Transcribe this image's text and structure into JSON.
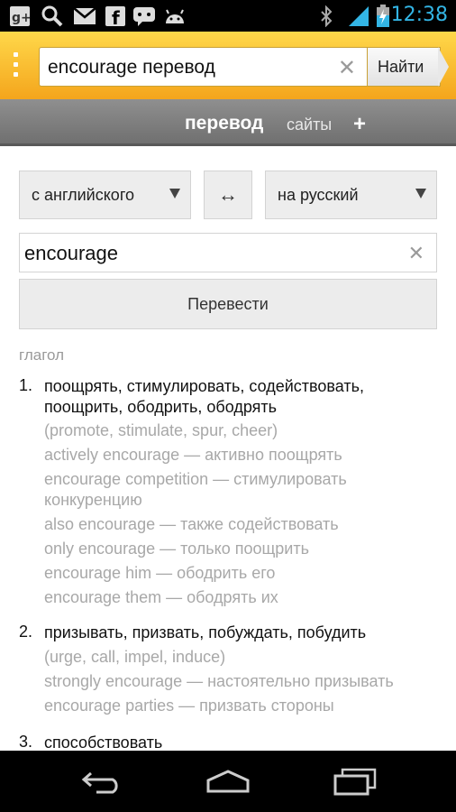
{
  "status_bar": {
    "time": "12:38",
    "left_icons": [
      "google-plus-icon",
      "search-icon",
      "gmail-icon",
      "facebook-icon",
      "talk-icon",
      "android-icon"
    ],
    "right_icons": [
      "bluetooth-icon",
      "signal-icon",
      "battery-charging-icon"
    ],
    "accent_color": "#33b5e5"
  },
  "search": {
    "query": "encourage перевод",
    "button_label": "Найти"
  },
  "tabs": [
    {
      "label": "перевод",
      "active": true
    },
    {
      "label": "сайты",
      "active": false
    },
    {
      "label": "+",
      "active": false
    }
  ],
  "translator": {
    "from_lang": "с английского",
    "to_lang": "на русский",
    "swap_symbol": "↔",
    "input_word": "encourage",
    "translate_label": "Перевести"
  },
  "results": {
    "part_of_speech": "глагол",
    "entries": [
      {
        "number": "1.",
        "main": "поощрять, стимулировать, содействовать, поощрить, ободрить, ободрять",
        "lines": [
          "(promote, stimulate, spur, cheer)",
          "actively encourage — активно поощрять",
          "encourage competition — стимулировать",
          "конкуренцию",
          "also encourage — также содействовать",
          "only encourage — только поощрить",
          "encourage him — ободрить его",
          "encourage them — ободрять их"
        ]
      },
      {
        "number": "2.",
        "main": "призывать, призвать, побуждать, побудить",
        "lines": [
          "(urge, call, impel, induce)",
          "strongly encourage — настоятельно призывать",
          "encourage parties — призвать стороны"
        ]
      },
      {
        "number": "3.",
        "main": "способствовать",
        "lines": []
      }
    ]
  },
  "nav_bar": {
    "buttons": [
      "back-icon",
      "home-icon",
      "recent-apps-icon"
    ]
  }
}
